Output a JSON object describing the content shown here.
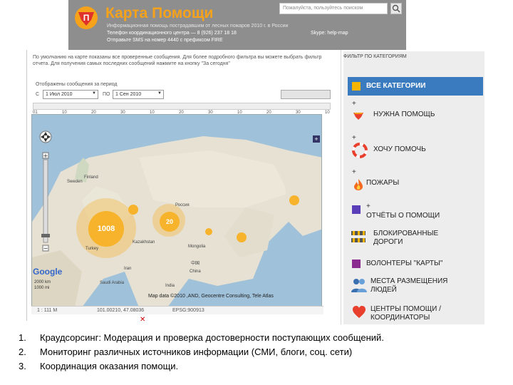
{
  "header": {
    "title": "Карта Помощи",
    "subtitle": "Информационная помощь пострадавшим от лесных пожаров 2010 г. в России",
    "phone_line": "Телефон координационного центра — 8 (926) 237 18 18",
    "skype": "Skype: help-map",
    "sms_line": "Отправьте SMS на номер 4440 с префиксом FIRE",
    "search_placeholder": "Пожалуйста, пользуйтесь поиском"
  },
  "main": {
    "instructions": "По умолчанию на карте показаны все проверенные сообщения. Для более подробного фильтра вы можете выбрать фильтр отчета. Для получения самых последних сообщений нажмите на кнопку \"За сегодня\"",
    "period_label": "Отображены сообщения за период",
    "from_label": "С",
    "to_label": "ПО",
    "from_date": "1 Июл 2010",
    "to_date": "1 Сен 2010",
    "timeline_ticks": [
      "01",
      "10",
      "20",
      "30",
      "10",
      "20",
      "30",
      "10",
      "20",
      "30",
      "10"
    ],
    "clusters": [
      "1008",
      "20"
    ],
    "map_labels": {
      "russia": "Россия",
      "kazakhstan": "Kazakhstan",
      "mongolia": "Mongolia",
      "china": "China",
      "china_zh": "中国",
      "india": "India",
      "saudi": "Saudi Arabia",
      "iran": "Iran",
      "turkey": "Turkey",
      "sweden": "Sweden",
      "finland": "Finland"
    },
    "google": "Google",
    "scale": [
      "2000 km",
      "1000 mi"
    ],
    "attribution": "Map data ©2010 ,AND, Geocentre Consulting, Tele Atlas",
    "coords": {
      "zoom": "1 : 111 M",
      "position": "101.00210, 47.08036",
      "projection": "EPSG:900913"
    }
  },
  "sidebar": {
    "filter_title": "ФИЛЬТР ПО КАТЕГОРИЯМ",
    "all_categories": "ВСЕ КАТЕГОРИИ",
    "categories": [
      {
        "label": "НУЖНА ПОМОЩЬ",
        "icon": "heart-hand-icon"
      },
      {
        "label": "ХОЧУ ПОМОЧЬ",
        "icon": "lifebuoy-icon"
      },
      {
        "label": "ПОЖАРЫ",
        "icon": "fire-icon"
      },
      {
        "label": "ОТЧЁТЫ О ПОМОЩИ",
        "icon": "purple-square",
        "color": "#5a3db8"
      },
      {
        "label": "БЛОКИРОВАННЫЕ",
        "label2": "ДОРОГИ",
        "icon": "roadblock-icon"
      },
      {
        "label": "ВОЛОНТЕРЫ \"КАРТЫ\"",
        "icon": "purple-square",
        "color": "#8b2a8f"
      },
      {
        "label": "МЕСТА РАЗМЕЩЕНИЯ",
        "label2": "ЛЮДЕЙ",
        "icon": "people-icon"
      },
      {
        "label": "ЦЕНТРЫ ПОМОЩИ /",
        "label2": "КООРДИНАТОРЫ",
        "icon": "heart-icon"
      }
    ],
    "colors": {
      "accent": "#3a7bbf",
      "all_square": "#f5b400"
    }
  },
  "list": [
    {
      "num": "1.",
      "text": "Краудсорсинг: Модерация и проверка достоверности поступающих сообщений."
    },
    {
      "num": "2.",
      "text": "Мониторинг различных источников информации (СМИ, блоги, соц. сети)"
    },
    {
      "num": "3.",
      "text": "Координация оказания помощи."
    }
  ]
}
